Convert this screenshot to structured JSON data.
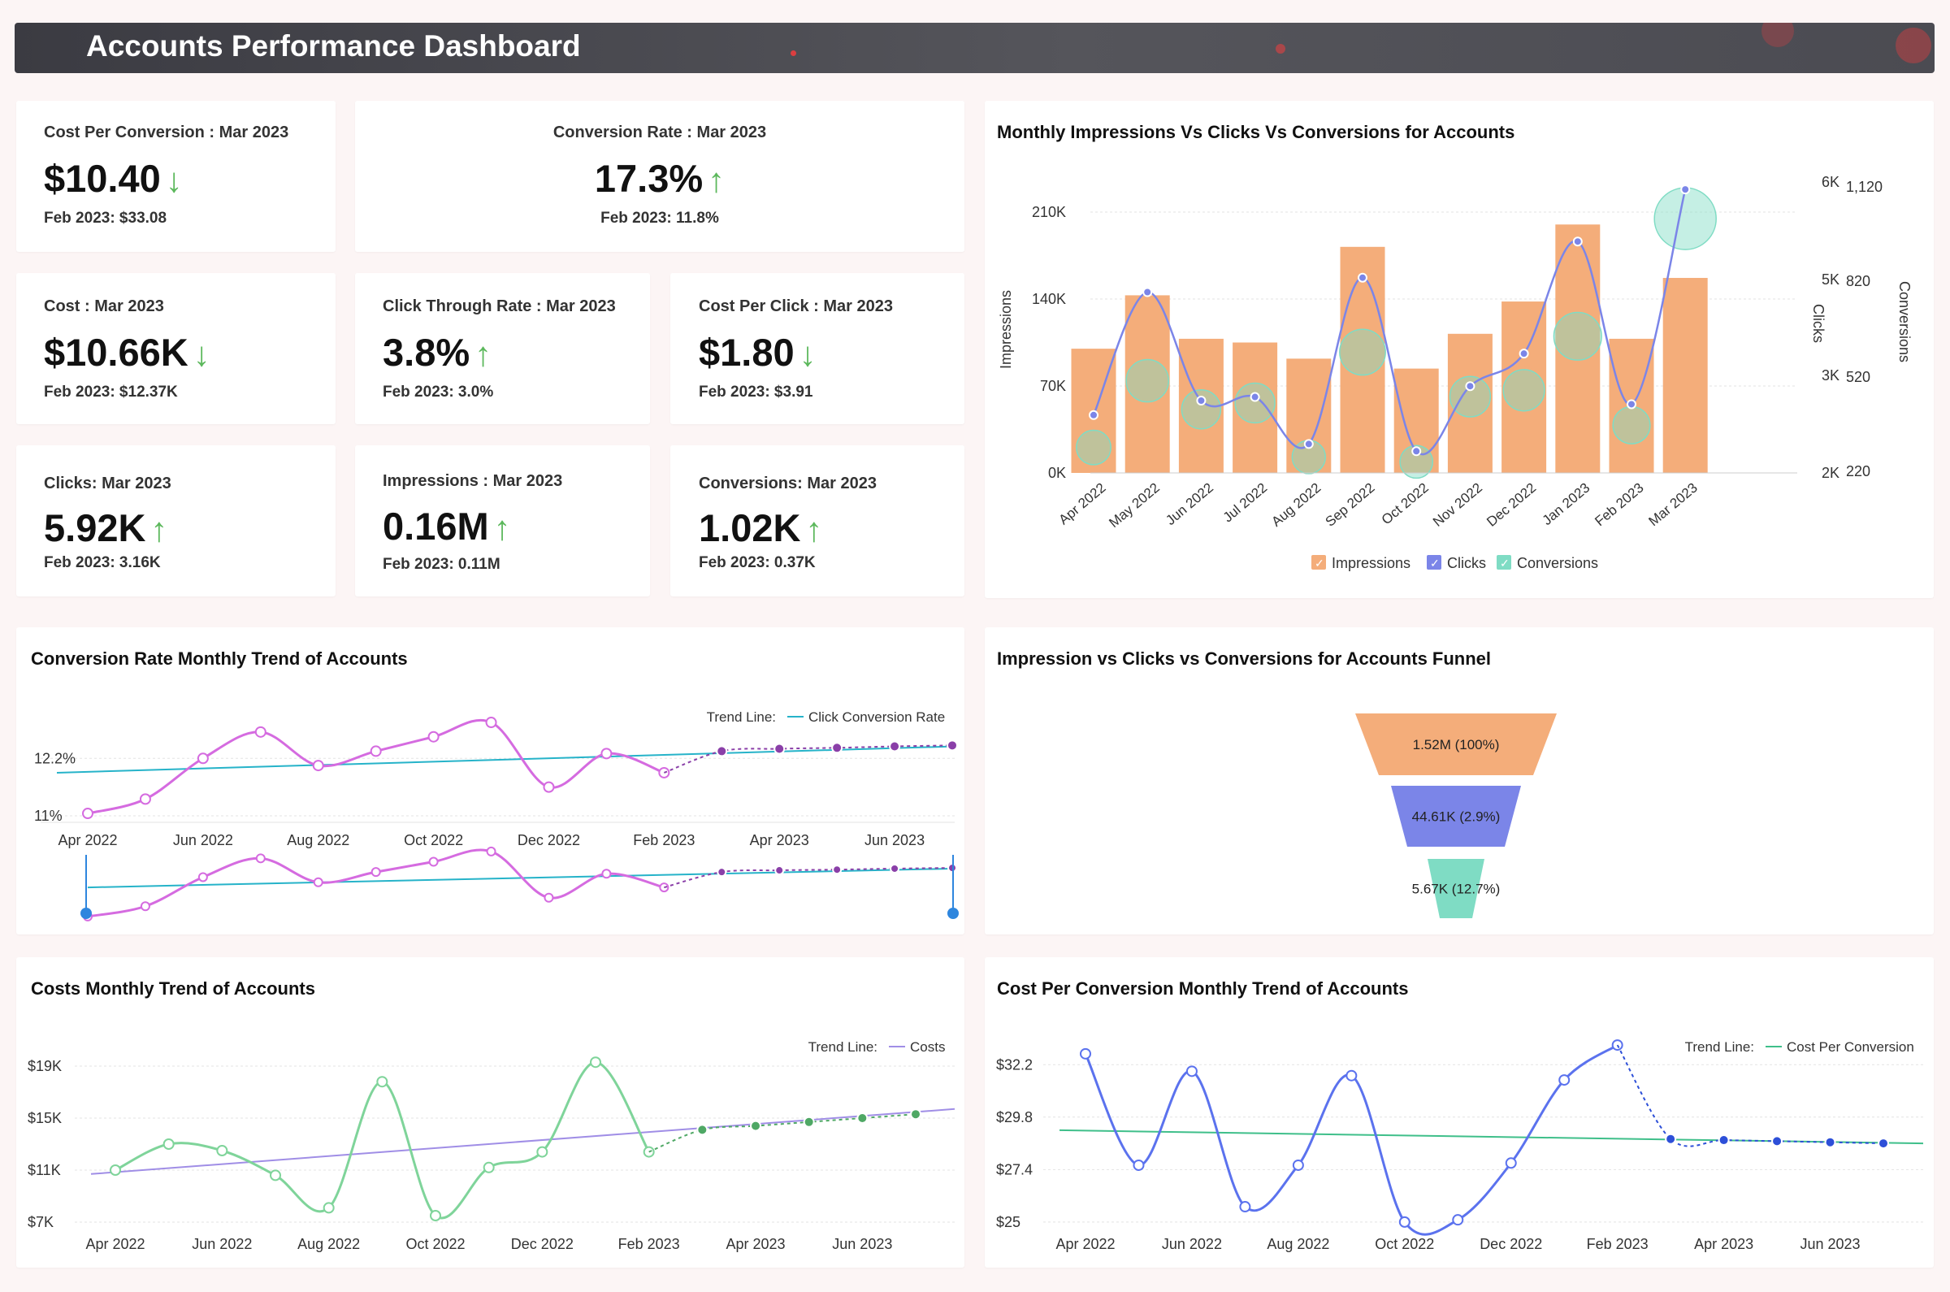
{
  "header": {
    "title": "Accounts Performance Dashboard"
  },
  "kpis": {
    "cpc_conv": {
      "label": "Cost Per Conversion : Mar 2023",
      "value": "$10.40",
      "trend": "down",
      "arrow": "↓",
      "prev": "Feb 2023: $33.08"
    },
    "conv_rate": {
      "label": "Conversion Rate : Mar 2023",
      "value": "17.3%",
      "trend": "up",
      "arrow": "↑",
      "prev": "Feb 2023: 11.8%"
    },
    "cost": {
      "label": "Cost : Mar 2023",
      "value": "$10.66K",
      "trend": "down",
      "arrow": "↓",
      "prev": "Feb 2023: $12.37K"
    },
    "ctr": {
      "label": "Click Through Rate : Mar 2023",
      "value": "3.8%",
      "trend": "up",
      "arrow": "↑",
      "prev": "Feb 2023: 3.0%"
    },
    "cpc": {
      "label": "Cost Per Click : Mar 2023",
      "value": "$1.80",
      "trend": "down",
      "arrow": "↓",
      "prev": "Feb 2023: $3.91"
    },
    "clicks": {
      "label": "Clicks: Mar 2023",
      "value": "5.92K",
      "trend": "up",
      "arrow": "↑",
      "prev": "Feb 2023: 3.16K"
    },
    "impressions": {
      "label": "Impressions : Mar 2023",
      "value": "0.16M",
      "trend": "up",
      "arrow": "↑",
      "prev": "Feb 2023: 0.11M"
    },
    "conversions": {
      "label": "Conversions: Mar 2023",
      "value": "1.02K",
      "trend": "up",
      "arrow": "↑",
      "prev": "Feb 2023: 0.37K"
    }
  },
  "colors": {
    "impressions": "#f4ad7a",
    "clicks": "#7b85e8",
    "conversions": "#7fdcc4",
    "rate_line": "#d56be0",
    "costs_line": "#7fd49a",
    "cpconv_line": "#5b72ee",
    "trend_blue": "#26b3c9",
    "trend_purple": "#a08ee6",
    "trend_green": "#3fbf8a"
  },
  "chart_data": [
    {
      "id": "impressions_clicks_conversions",
      "type": "bar",
      "title": "Monthly Impressions Vs Clicks Vs Conversions for Accounts",
      "categories": [
        "Apr 2022",
        "May 2022",
        "Jun 2022",
        "Jul 2022",
        "Aug 2022",
        "Sep 2022",
        "Oct 2022",
        "Nov 2022",
        "Dec 2022",
        "Jan 2023",
        "Feb 2023",
        "Mar 2023"
      ],
      "series": [
        {
          "name": "Impressions",
          "type": "bar",
          "axis": "Impressions",
          "values": [
            100000,
            143000,
            108000,
            105000,
            92000,
            182000,
            84000,
            112000,
            138000,
            200000,
            108000,
            157000
          ]
        },
        {
          "name": "Clicks",
          "type": "line",
          "axis": "Clicks",
          "values": [
            2800,
            4500,
            3000,
            3050,
            2400,
            4700,
            2300,
            3200,
            3650,
            5200,
            2950,
            5920
          ]
        },
        {
          "name": "Conversions",
          "type": "bubble",
          "axis": "Conversions",
          "values": [
            300,
            510,
            420,
            440,
            270,
            600,
            255,
            460,
            480,
            650,
            370,
            1020
          ]
        }
      ],
      "axes": {
        "Impressions": {
          "ticks": [
            "0K",
            "70K",
            "140K",
            "210K"
          ],
          "ylim": [
            0,
            210000
          ],
          "label": "Impressions"
        },
        "Clicks": {
          "ticks": [
            "2K",
            "3K",
            "5K",
            "6K"
          ],
          "ylim": [
            2000,
            6000
          ],
          "label": "Clicks"
        },
        "Conversions": {
          "ticks": [
            "220",
            "520",
            "820",
            "1,120"
          ],
          "ylim": [
            220,
            1120
          ],
          "label": "Conversions"
        }
      },
      "legend": [
        "Impressions",
        "Clicks",
        "Conversions"
      ],
      "legend_position": "bottom"
    },
    {
      "id": "conversion_rate_trend",
      "type": "line",
      "title": "Conversion Rate Monthly Trend of Accounts",
      "x_ticks": [
        "Apr 2022",
        "Jun 2022",
        "Aug 2022",
        "Oct 2022",
        "Dec 2022",
        "Feb 2023",
        "Apr 2023",
        "Jun 2023"
      ],
      "y_ticks": [
        "11%",
        "12.2%"
      ],
      "ylim": [
        11.0,
        12.9
      ],
      "trend_label": "Trend Line:",
      "trend_name": "Click Conversion Rate",
      "actual": [
        11.05,
        11.35,
        12.2,
        12.75,
        12.05,
        12.35,
        12.65,
        12.95,
        11.6,
        12.3,
        11.9
      ],
      "forecast": [
        11.9,
        12.35,
        12.4,
        12.42,
        12.45,
        12.47
      ],
      "trend_start": 11.9,
      "trend_end": 12.45
    },
    {
      "id": "conversion_funnel",
      "type": "funnel",
      "title": "Impression vs Clicks vs Conversions for Accounts Funnel",
      "stages": [
        {
          "name": "Impressions",
          "label": "1.52M (100%)"
        },
        {
          "name": "Clicks",
          "label": "44.61K (2.9%)"
        },
        {
          "name": "Conversions",
          "label": "5.67K (12.7%)"
        }
      ]
    },
    {
      "id": "costs_trend",
      "type": "line",
      "title": "Costs Monthly Trend of Accounts",
      "x_ticks": [
        "Apr 2022",
        "Jun 2022",
        "Aug 2022",
        "Oct 2022",
        "Dec 2022",
        "Feb 2023",
        "Apr 2023",
        "Jun 2023"
      ],
      "y_ticks": [
        "$7K",
        "$11K",
        "$15K",
        "$19K"
      ],
      "ylim": [
        7000,
        19000
      ],
      "trend_label": "Trend Line:",
      "trend_name": "Costs",
      "actual": [
        11000,
        13000,
        12500,
        10600,
        8100,
        17800,
        7500,
        11200,
        12400,
        19300,
        12400
      ],
      "forecast": [
        12400,
        14100,
        14400,
        14700,
        15000,
        15300
      ],
      "trend_start": 10700,
      "trend_end": 15700
    },
    {
      "id": "cost_per_conversion_trend",
      "type": "line",
      "title": "Cost Per Conversion Monthly Trend of Accounts",
      "x_ticks": [
        "Apr 2022",
        "Jun 2022",
        "Aug 2022",
        "Oct 2022",
        "Dec 2022",
        "Feb 2023",
        "Apr 2023",
        "Jun 2023"
      ],
      "y_ticks": [
        "$25",
        "$27.4",
        "$29.8",
        "$32.2"
      ],
      "ylim": [
        24.4,
        33.4
      ],
      "trend_label": "Trend Line:",
      "trend_name": "Cost Per Conversion",
      "actual": [
        32.7,
        27.6,
        31.9,
        25.7,
        27.6,
        31.7,
        25.0,
        25.1,
        27.7,
        31.5,
        33.1
      ],
      "forecast": [
        33.1,
        28.8,
        28.75,
        28.7,
        28.65,
        28.6
      ],
      "trend_start": 29.2,
      "trend_end": 28.6
    }
  ]
}
